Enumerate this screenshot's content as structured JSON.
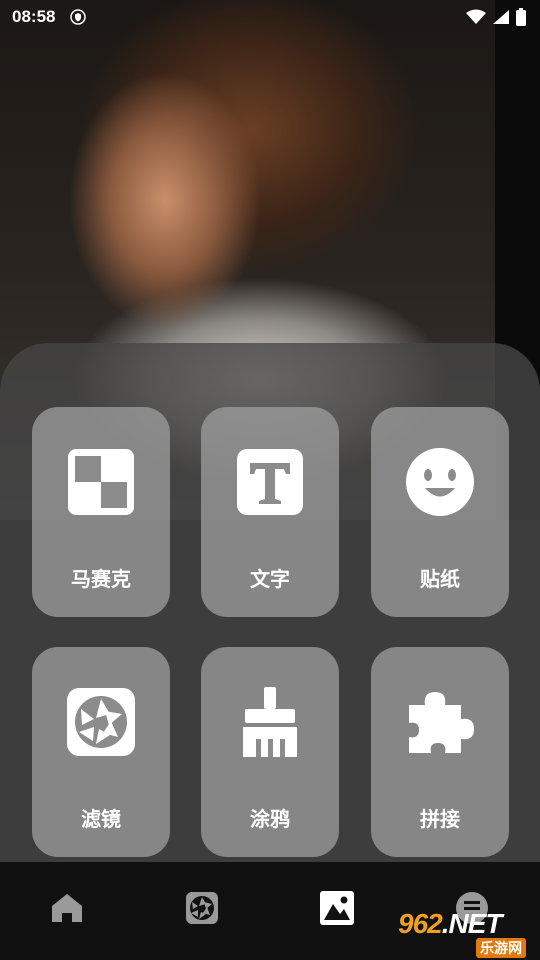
{
  "status_bar": {
    "time": "08:58"
  },
  "tools": [
    {
      "label": "马赛克",
      "icon": "mosaic-icon"
    },
    {
      "label": "文字",
      "icon": "text-icon"
    },
    {
      "label": "贴纸",
      "icon": "sticker-smile-icon"
    },
    {
      "label": "滤镜",
      "icon": "aperture-filter-icon"
    },
    {
      "label": "涂鸦",
      "icon": "brush-icon"
    },
    {
      "label": "拼接",
      "icon": "puzzle-icon"
    }
  ],
  "bottom_nav": {
    "items": [
      {
        "icon": "home-icon",
        "active": false
      },
      {
        "icon": "aperture-icon",
        "active": false
      },
      {
        "icon": "image-icon",
        "active": true
      },
      {
        "icon": "profile-icon",
        "active": false
      }
    ]
  },
  "watermark": {
    "top": "962",
    "net": ".NET",
    "bottom": "乐游网"
  },
  "colors": {
    "tile_bg": "#9b9b9b",
    "panel_bg": "#464646",
    "nav_bg": "#111111",
    "icon_inactive": "#9a9a9a",
    "icon_active": "#ffffff"
  }
}
